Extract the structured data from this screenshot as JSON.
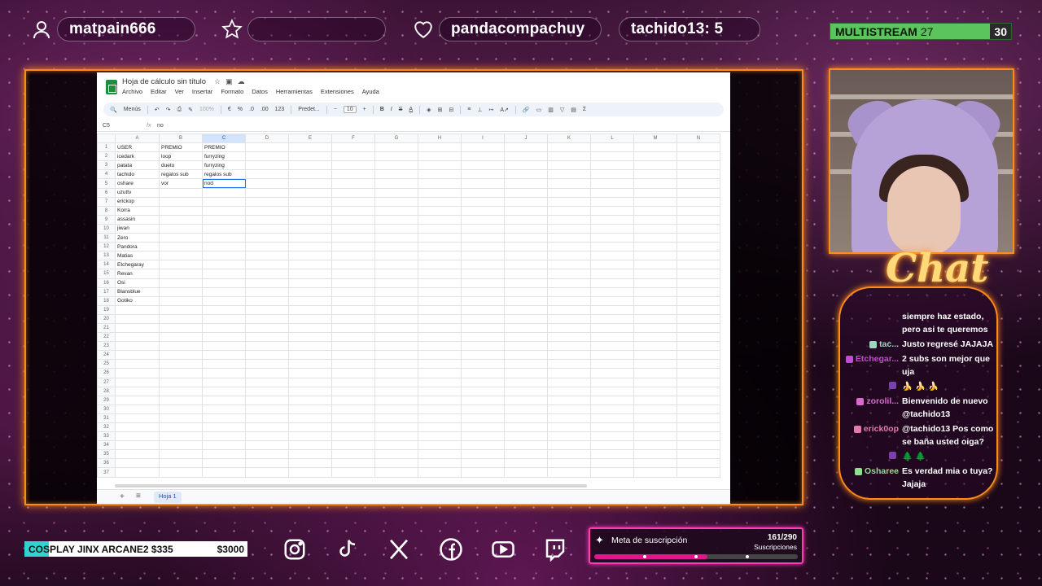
{
  "overlay": {
    "top_users": [
      {
        "icon": "person-icon",
        "name": "matpain666"
      },
      {
        "icon": "star-icon",
        "name": ""
      },
      {
        "icon": "heart-icon",
        "name": "pandacompachuy"
      },
      {
        "icon": "",
        "name": "tachido13: 5"
      }
    ],
    "multistream": {
      "label": "MULTISTREAM",
      "count": "27",
      "max": "30",
      "color": "#5cc45c"
    },
    "accent_color": "#ff8c1a"
  },
  "sheets": {
    "doc_title": "Hoja de cálculo sin título",
    "menus": [
      "Archivo",
      "Editar",
      "Ver",
      "Insertar",
      "Formato",
      "Datos",
      "Herramientas",
      "Extensiones",
      "Ayuda"
    ],
    "toolbar": {
      "menus_label": "Menús",
      "zoom": "100%",
      "currency": "€",
      "percent": "%",
      "number": "123",
      "font": "Predet...",
      "font_size": "10"
    },
    "cell_ref": "C5",
    "formula_value": "no",
    "columns": [
      "A",
      "B",
      "C",
      "D",
      "E",
      "F",
      "G",
      "H",
      "I",
      "J",
      "K",
      "L",
      "M",
      "N"
    ],
    "rows": [
      [
        "USER",
        "PREMIO",
        "PREMIO"
      ],
      [
        "icedark",
        "loop",
        "furryzing"
      ],
      [
        "patata",
        "dueto",
        "furryzing"
      ],
      [
        "tachido",
        "regalos sub",
        "regalos sub"
      ],
      [
        "oshare",
        "vor",
        "nod"
      ],
      [
        "uzuttv",
        "",
        ""
      ],
      [
        "erickop",
        "",
        ""
      ],
      [
        "Korra",
        "",
        ""
      ],
      [
        "assasin",
        "",
        ""
      ],
      [
        "jiwan",
        "",
        ""
      ],
      [
        "Zero",
        "",
        ""
      ],
      [
        "Pandora",
        "",
        ""
      ],
      [
        "Matias",
        "",
        ""
      ],
      [
        "Etchegaray",
        "",
        ""
      ],
      [
        "Revan",
        "",
        ""
      ],
      [
        "Osi",
        "",
        ""
      ],
      [
        "Blansblue",
        "",
        ""
      ],
      [
        "Gotiko",
        "",
        ""
      ]
    ],
    "total_rows": 37,
    "sheet_tab": "Hoja 1"
  },
  "chat": {
    "title": "Chat",
    "messages": [
      {
        "user": "",
        "color": "#ffffff",
        "text": "siempre haz estado, pero asi te queremos"
      },
      {
        "user": "tac...",
        "color": "#9cd8c0",
        "text": "Justo regresé JAJAJA"
      },
      {
        "user": "Etchegar...",
        "color": "#c04cd8",
        "text": "2 subs son mejor que uja"
      },
      {
        "user": "",
        "color": "#7a3fb0",
        "text": "🍌 🍌 🍌"
      },
      {
        "user": "zorolil...",
        "color": "#d86ad0",
        "text": "Bienvenido de nuevo @tachido13"
      },
      {
        "user": "erick0op",
        "color": "#e07ab0",
        "text": "@tachido13 Pos como se baña usted oiga?"
      },
      {
        "user": "",
        "color": "#7a3fb0",
        "text": "🌲 🌲"
      },
      {
        "user": "Osharee",
        "color": "#8ee08e",
        "text": "Es verdad mia o tuya? Jajaja"
      }
    ]
  },
  "bottom": {
    "goal_text": "COSPLAY JINX ARCANE2 $335",
    "goal_target": "$3000",
    "goal_progress": 0.11,
    "goal_color": "#2fd3cf",
    "socials": [
      "instagram-icon",
      "tiktok-icon",
      "x-icon",
      "facebook-icon",
      "youtube-icon",
      "twitch-icon"
    ],
    "sub_goal": {
      "label": "Meta de suscripción",
      "count": "161/290",
      "caption": "Suscripciones",
      "progress": 0.555,
      "color": "#e0168c"
    }
  }
}
